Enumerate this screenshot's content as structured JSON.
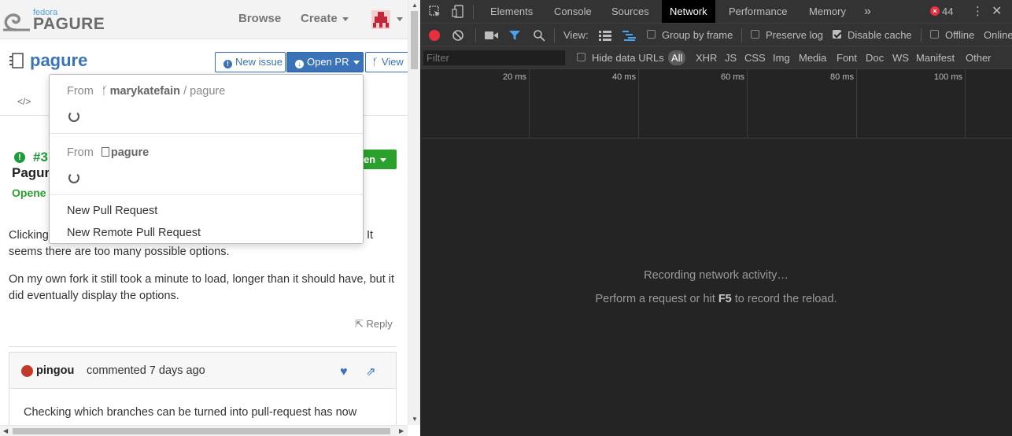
{
  "pagure": {
    "logo_small": "fedora",
    "logo_main": "PAGURE",
    "nav": {
      "browse": "Browse",
      "create": "Create"
    },
    "repo_name": "pagure",
    "buttons": {
      "new_issue": "New issue",
      "open_pr": "Open PR",
      "view": "View"
    },
    "code_tab": "</>",
    "issue": {
      "number": "#3",
      "title": "Pagur",
      "opened": "Opene",
      "status_button": "pen"
    },
    "paragraphs": [
      "Clicking ... It seems there are too many possible options.",
      "On my own fork it still took a minute to load, longer than it should have, but it did eventually display the options."
    ],
    "para1_left": "Clicking",
    "para1_right": "It",
    "para1_line2": "seems there are too many possible options.",
    "reply": "Reply",
    "comment": {
      "user": "pingou",
      "action": "commented 7 days ago",
      "body": "Checking which branches can be turned into pull-request has now"
    },
    "dropdown": {
      "from_label": "From",
      "fork_user": "marykatefain",
      "fork_sep": "/",
      "fork_repo": "pagure",
      "main_repo": "pagure",
      "new_pr": "New Pull Request",
      "new_remote_pr": "New Remote Pull Request"
    }
  },
  "devtools": {
    "tabs": [
      "Elements",
      "Console",
      "Sources",
      "Network",
      "Performance",
      "Memory"
    ],
    "active_tab": "Network",
    "more": "»",
    "error_count": "44",
    "toolbar": {
      "view_label": "View:",
      "group_by_frame": "Group by frame",
      "preserve_log": "Preserve log",
      "disable_cache": "Disable cache",
      "offline": "Offline",
      "online": "Online"
    },
    "filter": {
      "placeholder": "Filter",
      "hide_data_urls": "Hide data URLs",
      "types": [
        "All",
        "XHR",
        "JS",
        "CSS",
        "Img",
        "Media",
        "Font",
        "Doc",
        "WS",
        "Manifest",
        "Other"
      ]
    },
    "timeline_labels": [
      "20 ms",
      "40 ms",
      "60 ms",
      "80 ms",
      "100 ms"
    ],
    "message_recording": "Recording network activity…",
    "message_hint_pre": "Perform a request or hit",
    "message_hint_key": "F5",
    "message_hint_post": "to record the reload.",
    "colors": {
      "record": "#e6303f",
      "active_tab_bg": "#000000",
      "panel_bg": "#242424"
    }
  }
}
